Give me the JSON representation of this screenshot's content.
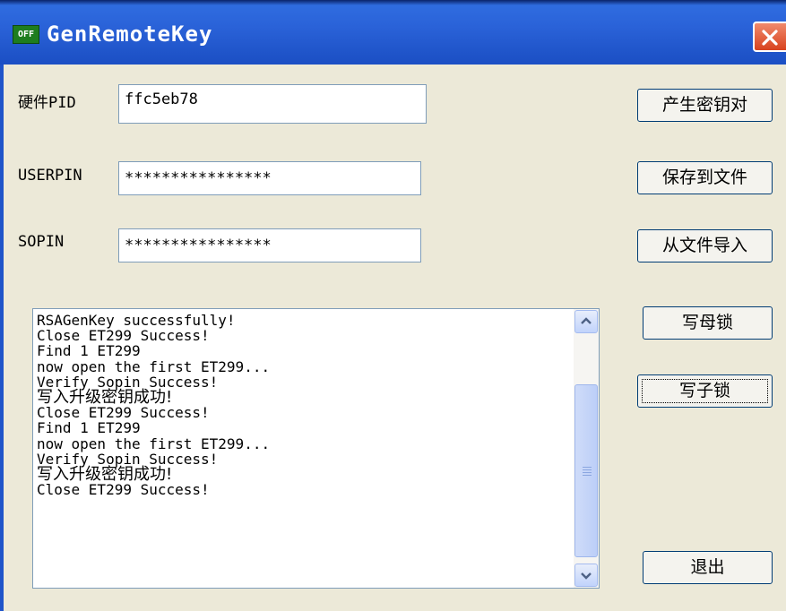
{
  "window": {
    "title": "GenRemoteKey",
    "icon_text": "OFF",
    "icon": "app-icon",
    "close_icon": "close-icon",
    "colors": {
      "titlebar": "#2a62d8",
      "close": "#d8421e",
      "client": "#ece9d8"
    }
  },
  "form": {
    "pid": {
      "label": "硬件PID",
      "value": "ffc5eb78"
    },
    "userpin": {
      "label": "USERPIN",
      "value": "****************"
    },
    "sopin": {
      "label": "SOPIN",
      "value": "****************"
    }
  },
  "buttons": {
    "gen_keypair": "产生密钥对",
    "save_to_file": "保存到文件",
    "import_from_file": "从文件导入",
    "write_master": "写母锁",
    "write_child": "写子锁",
    "exit": "退出"
  },
  "log": {
    "lines": [
      "RSAGenKey successfully!",
      "Close ET299 Success!",
      "Find 1 ET299",
      "now open the first ET299...",
      "Verify Sopin Success!",
      "写入升级密钥成功!",
      "Close ET299 Success!",
      "Find 1 ET299",
      "now open the first ET299...",
      "Verify Sopin Success!",
      "写入升级密钥成功!",
      "Close ET299 Success!"
    ]
  }
}
